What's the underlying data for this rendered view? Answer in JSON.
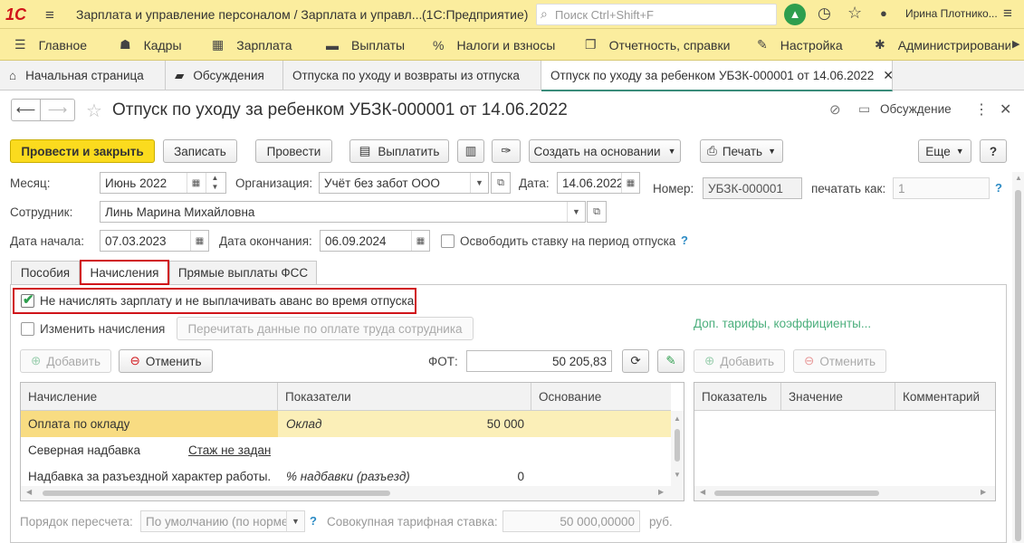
{
  "app": {
    "logo": "1С",
    "title": "Зарплата и управление персоналом / Зарплата и управл...",
    "platform": "(1С:Предприятие)",
    "search_placeholder": "Поиск Ctrl+Shift+F",
    "user": "Ирина Плотнико..."
  },
  "menu": {
    "items": [
      {
        "label": "Главное",
        "icon": "menu-lines-icon"
      },
      {
        "label": "Кадры",
        "icon": "people-icon"
      },
      {
        "label": "Зарплата",
        "icon": "calculator-icon"
      },
      {
        "label": "Выплаты",
        "icon": "wallet-icon"
      },
      {
        "label": "Налоги и взносы",
        "icon": "percent-icon"
      },
      {
        "label": "Отчетность, справки",
        "icon": "report-icon"
      },
      {
        "label": "Настройка",
        "icon": "wrench-icon"
      },
      {
        "label": "Администрировани",
        "icon": "gear-icon"
      }
    ]
  },
  "tabs": [
    {
      "label": "Начальная страница"
    },
    {
      "label": "Обсуждения"
    },
    {
      "label": "Отпуска по уходу и возвраты из отпуска"
    },
    {
      "label": "Отпуск по уходу за ребенком УБЗК-000001 от 14.06.2022"
    }
  ],
  "doc": {
    "title": "Отпуск по уходу за ребенком УБЗК-000001 от 14.06.2022",
    "discussion": "Обсуждение"
  },
  "toolbar": {
    "post_close": "Провести и закрыть",
    "save": "Записать",
    "post": "Провести",
    "pay": "Выплатить",
    "create_based": "Создать на основании",
    "print": "Печать",
    "more": "Еще",
    "help": "?"
  },
  "form": {
    "month_label": "Месяц:",
    "month": "Июнь 2022",
    "org_label": "Организация:",
    "org": "Учёт без забот ООО",
    "date_label": "Дата:",
    "date": "14.06.2022",
    "number_label": "Номер:",
    "number": "УБЗК-000001",
    "print_as_label": "печатать как:",
    "print_as": "1",
    "employee_label": "Сотрудник:",
    "employee": "Линь Марина Михайловна",
    "start_label": "Дата начала:",
    "start": "07.03.2023",
    "end_label": "Дата окончания:",
    "end": "06.09.2024",
    "free_rate": "Освободить ставку на период отпуска"
  },
  "subtabs": [
    "Пособия",
    "Начисления",
    "Прямые выплаты ФСС"
  ],
  "accruals": {
    "no_salary": "Не начислять зарплату и не выплачивать аванс во время отпуска",
    "change": "Изменить начисления",
    "reread": "Перечитать данные по оплате труда сотрудника",
    "extra_link": "Доп. тарифы, коэффициенты...",
    "add": "Добавить",
    "cancel": "Отменить",
    "fot_label": "ФОТ:",
    "fot": "50 205,83",
    "columns": [
      "Начисление",
      "Показатели",
      "Основание"
    ],
    "rows": [
      {
        "name": "Оплата по окладу",
        "indicator": "Оклад",
        "value": "50 000",
        "extra": ""
      },
      {
        "name": "Северная надбавка",
        "indicator": "",
        "value": "",
        "extra": "Стаж не задан"
      },
      {
        "name": "Надбавка за разъездной характер работы.",
        "indicator": "% надбавки (разъезд)",
        "value": "0",
        "extra": ""
      }
    ],
    "right_add": "Добавить",
    "right_cancel": "Отменить",
    "right_columns": [
      "Показатель",
      "Значение",
      "Комментарий"
    ],
    "recalc_label": "Порядок пересчета:",
    "recalc": "По умолчанию (по норме",
    "total_rate_label": "Совокупная тарифная ставка:",
    "total_rate": "50 000,00000",
    "currency": "руб."
  },
  "colors": {
    "accent": "#fbdb1e",
    "panel": "#fbed9e",
    "highlight": "#d0141a"
  }
}
